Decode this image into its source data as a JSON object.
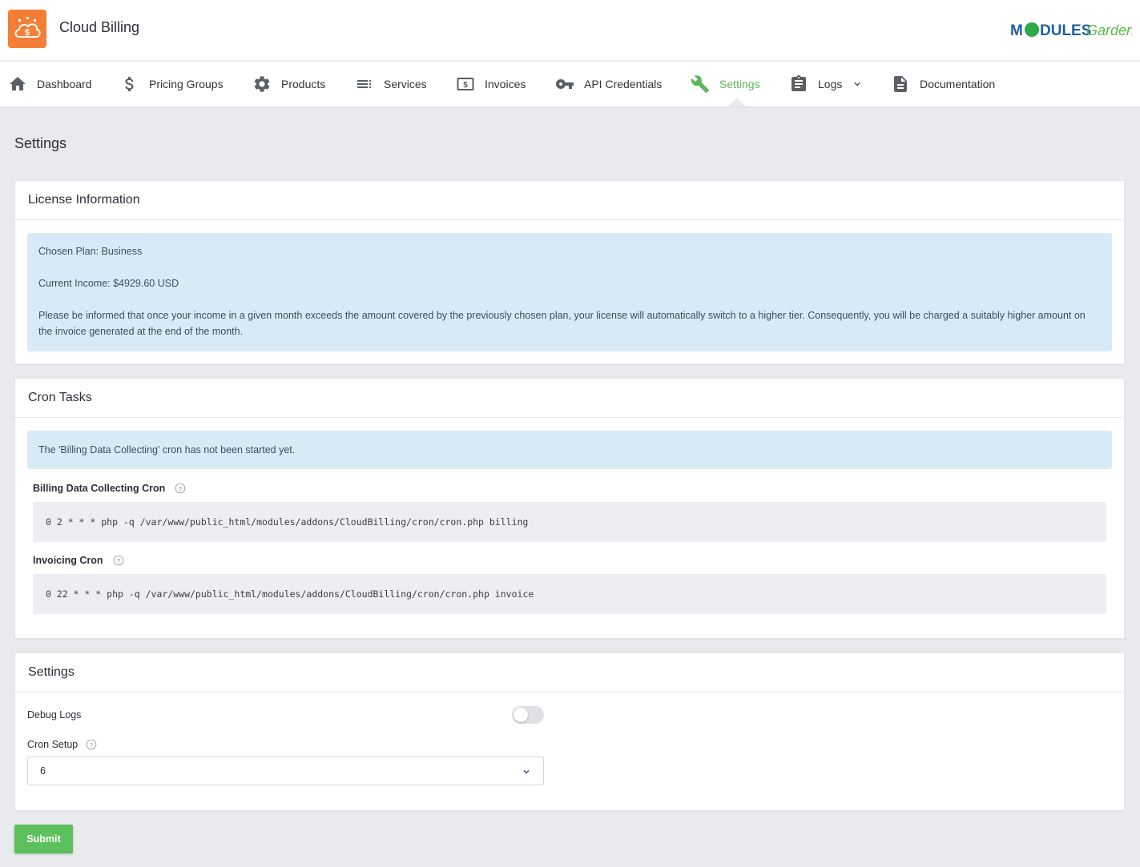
{
  "app": {
    "title": "Cloud Billing"
  },
  "brand": {
    "part1": "M",
    "part2": "DULES",
    "part3": "Garden"
  },
  "nav": {
    "items": [
      {
        "label": "Dashboard",
        "icon": "home-icon"
      },
      {
        "label": "Pricing Groups",
        "icon": "dollar-icon"
      },
      {
        "label": "Products",
        "icon": "gear-icon"
      },
      {
        "label": "Services",
        "icon": "list-icon"
      },
      {
        "label": "Invoices",
        "icon": "invoice-icon"
      },
      {
        "label": "API Credentials",
        "icon": "key-icon"
      },
      {
        "label": "Settings",
        "icon": "wrench-icon",
        "active": true
      },
      {
        "label": "Logs",
        "icon": "clipboard-icon",
        "dropdown": true
      },
      {
        "label": "Documentation",
        "icon": "document-icon"
      }
    ]
  },
  "page": {
    "title": "Settings"
  },
  "license": {
    "title": "License Information",
    "plan": "Chosen Plan: Business",
    "income": "Current Income: $4929.60 USD",
    "notice": "Please be informed that once your income in a given month exceeds the amount covered by the previously chosen plan, your license will automatically switch to a higher tier. Consequently, you will be charged a suitably higher amount on the invoice generated at the end of the month."
  },
  "cron": {
    "title": "Cron Tasks",
    "alert": "The 'Billing Data Collecting' cron has not been started yet.",
    "billing_label": "Billing Data Collecting Cron",
    "billing_command": "0 2 * * * php -q /var/www/public_html/modules/addons/CloudBilling/cron/cron.php billing",
    "invoicing_label": "Invoicing Cron",
    "invoicing_command": "0 22 * * * php -q /var/www/public_html/modules/addons/CloudBilling/cron/cron.php invoice"
  },
  "settings": {
    "title": "Settings",
    "debug_label": "Debug Logs",
    "debug_enabled": false,
    "cron_setup_label": "Cron Setup",
    "cron_setup_value": "6"
  },
  "actions": {
    "submit_label": "Submit"
  },
  "colors": {
    "accent": "#5cb85c",
    "logo": "#f47e35",
    "alert_bg": "#d8eaf5"
  }
}
